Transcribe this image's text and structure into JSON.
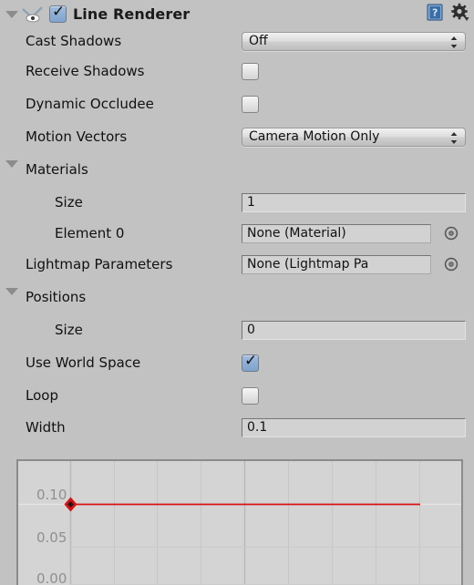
{
  "component": {
    "title": "Line Renderer",
    "enabled": true,
    "expanded": true,
    "icon": "line-renderer-icon",
    "help_icon": "help-book-icon",
    "settings_icon": "gear-icon"
  },
  "properties": {
    "cast_shadows": {
      "label": "Cast Shadows",
      "value": "Off"
    },
    "receive_shadows": {
      "label": "Receive Shadows",
      "checked": false
    },
    "dynamic_occludee": {
      "label": "Dynamic Occludee",
      "checked": false
    },
    "motion_vectors": {
      "label": "Motion Vectors",
      "value": "Camera Motion Only"
    },
    "materials": {
      "label": "Materials",
      "expanded": true,
      "size": {
        "label": "Size",
        "value": "1"
      },
      "elements": [
        {
          "label": "Element 0",
          "value": "None (Material)"
        }
      ]
    },
    "lightmap_parameters": {
      "label": "Lightmap Parameters",
      "value": "None (Lightmap Pa"
    },
    "positions": {
      "label": "Positions",
      "expanded": true,
      "size": {
        "label": "Size",
        "value": "0"
      }
    },
    "use_world_space": {
      "label": "Use World Space",
      "checked": true
    },
    "loop": {
      "label": "Loop",
      "checked": false
    },
    "width": {
      "label": "Width",
      "value": "0.1"
    }
  },
  "curve_editor": {
    "y_labels": [
      "0.10",
      "0.05",
      "0.00"
    ],
    "curve_color": "#d81010",
    "keyframe_color": "#d81010",
    "value": 0.1,
    "grid_color": "#c6c6c6",
    "background": "#d4d4d4"
  },
  "colors": {
    "window_background": "#c2c2c2",
    "field_background": "#d2d2d2",
    "checkbox_on": "#7fa3cd",
    "curve": "#d81010"
  }
}
